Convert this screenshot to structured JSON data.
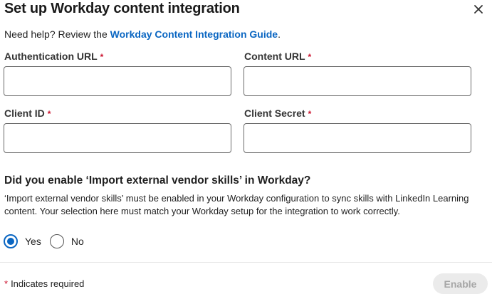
{
  "dialog": {
    "title": "Set up Workday content integration",
    "close_icon": "close-icon"
  },
  "help": {
    "prefix": "Need help? Review the ",
    "link_label": "Workday Content Integration Guide",
    "suffix": "."
  },
  "fields": {
    "auth_url": {
      "label": "Authentication URL",
      "required_mark": "*",
      "value": ""
    },
    "content_url": {
      "label": "Content URL",
      "required_mark": "*",
      "value": ""
    },
    "client_id": {
      "label": "Client ID",
      "required_mark": "*",
      "value": ""
    },
    "client_secret": {
      "label": "Client Secret",
      "required_mark": "*",
      "value": ""
    }
  },
  "question": {
    "title": "Did you enable ‘Import external vendor skills’ in Workday?",
    "description": "‘Import external vendor skills’ must be enabled in your Workday configuration to sync skills with LinkedIn Learning content. Your selection here must match your Workday setup for the integration to work correctly.",
    "options": [
      {
        "label": "Yes",
        "checked": true
      },
      {
        "label": "No",
        "checked": false
      }
    ]
  },
  "footer": {
    "required_mark": "*",
    "required_note": "Indicates required",
    "enable_label": "Enable",
    "enable_disabled": true
  },
  "colors": {
    "accent": "#0a66c2",
    "required": "#cb112d",
    "disabled_bg": "#ebebeb",
    "disabled_text": "#a6a6a6"
  }
}
